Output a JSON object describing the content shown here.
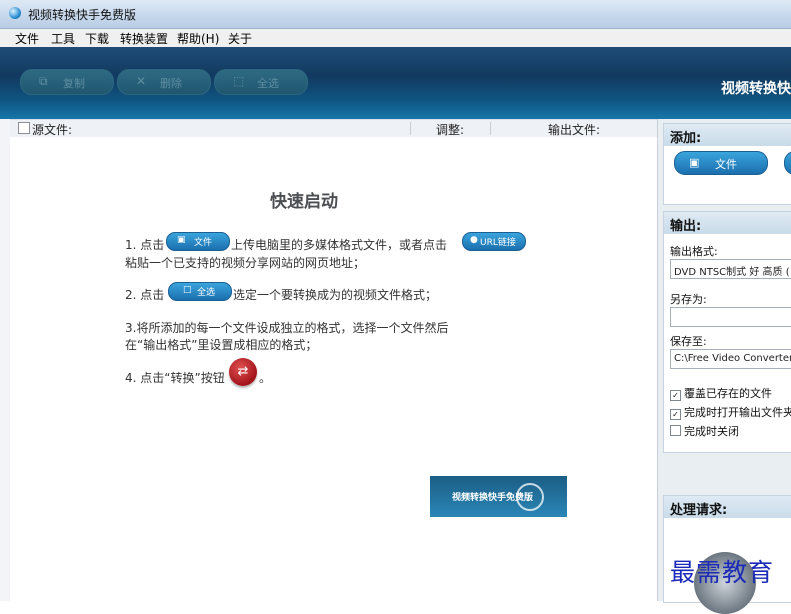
{
  "window": {
    "title": "视频转换快手免费版"
  },
  "menu": [
    "文件",
    "工具",
    "下载",
    "转换装置",
    "帮助(H)",
    "关于"
  ],
  "toolbar": {
    "copy_label": "复制",
    "delete_label": "删除",
    "select_all_label": "全选",
    "brand": "视频转换快"
  },
  "file_list": {
    "columns": [
      "源文件:",
      "调整:",
      "输出文件:"
    ]
  },
  "quick_start": {
    "title": "快速启动",
    "step1_a": "1. 点击",
    "step1_btn": "文件",
    "step1_b": "上传电脑里的多媒体格式文件，或者点击",
    "step1_url_btn": "URL链接",
    "step1_c": "粘贴一个已支持的视频分享网站的网页地址；",
    "step2_a": "2. 点击",
    "step2_btn": "全选",
    "step2_b": "选定一个要转换成为的视频文件格式；",
    "step3_a": "3.将所添加的每一个文件设成独立的格式，选择一个文件然后",
    "step3_b": "在“输出格式”里设置成相应的格式；",
    "step4_a": "4. 点击“转换”按钮",
    "step4_b": "。",
    "promo": "视频转换快手免费版"
  },
  "add_panel": {
    "title": "添加:",
    "file_button": "文件"
  },
  "output_panel": {
    "title": "输出:",
    "format_label": "输出格式:",
    "format_value": "DVD NTSC制式 好 高质 (",
    "save_as_label": "另存为:",
    "save_as_value": "",
    "save_to_label": "保存至:",
    "save_to_value": "C:\\Free Video Converter f",
    "overwrite_label": "覆盖已存在的文件",
    "open_folder_label": "完成时打开输出文件夹",
    "shutdown_label": "完成时关闭"
  },
  "process_panel": {
    "title": "处理请求:"
  },
  "watermark": "最需教育"
}
